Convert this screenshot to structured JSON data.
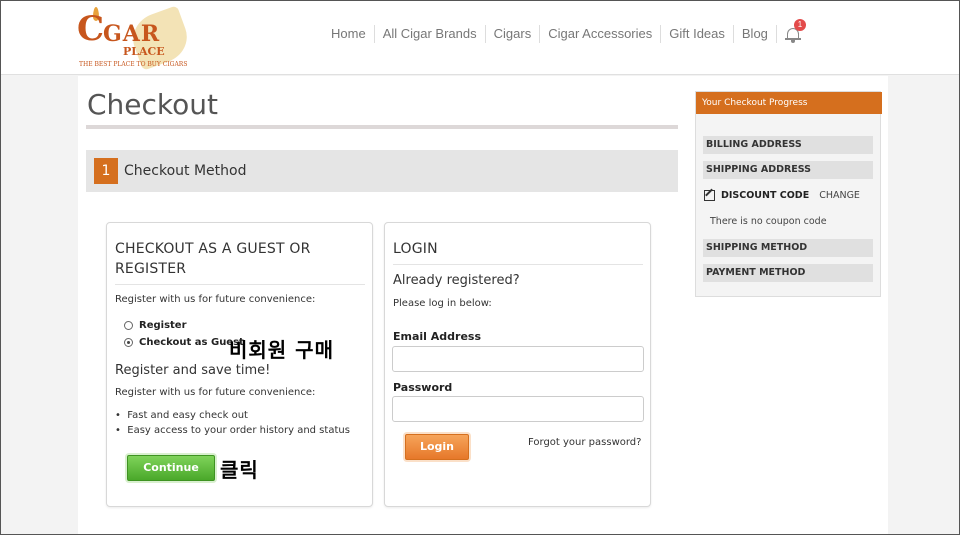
{
  "header": {
    "logo": {
      "c": "C",
      "gar": "GAR",
      "place": "PLACE",
      "tagline": "THE BEST PLACE TO BUY CIGARS"
    },
    "nav": [
      "Home",
      "All Cigar Brands",
      "Cigars",
      "Cigar Accessories",
      "Gift Ideas",
      "Blog"
    ],
    "notification_count": "1"
  },
  "page": {
    "title": "Checkout",
    "step_number": "1",
    "step_label": "Checkout Method"
  },
  "guest_box": {
    "title": "CHECKOUT AS A GUEST OR REGISTER",
    "intro": "Register with us for future convenience:",
    "options": [
      "Register",
      "Checkout as Guest"
    ],
    "selected_option": "Checkout as Guest",
    "subheading": "Register and save time!",
    "benefits_intro": "Register with us for future convenience:",
    "benefits": [
      "Fast and easy check out",
      "Easy access to your order history and status"
    ],
    "continue_label": "Continue"
  },
  "annotations": {
    "guest_purchase": "비회원 구매",
    "click": "클릭"
  },
  "login_box": {
    "title": "LOGIN",
    "already": "Already registered?",
    "please": "Please log in below:",
    "email_label": "Email Address",
    "email_value": "",
    "password_label": "Password",
    "password_value": "",
    "login_label": "Login",
    "forgot": "Forgot your password?"
  },
  "progress": {
    "title": "Your Checkout Progress",
    "billing": "BILLING ADDRESS",
    "shipping": "SHIPPING ADDRESS",
    "discount": "DISCOUNT CODE",
    "change": "CHANGE",
    "no_coupon": "There is no coupon code",
    "shipping_method": "SHIPPING METHOD",
    "payment_method": "PAYMENT METHOD"
  },
  "colors": {
    "accent": "#d56f1e",
    "continue_green": "#4aa82a",
    "badge_red": "#e34b4b"
  }
}
